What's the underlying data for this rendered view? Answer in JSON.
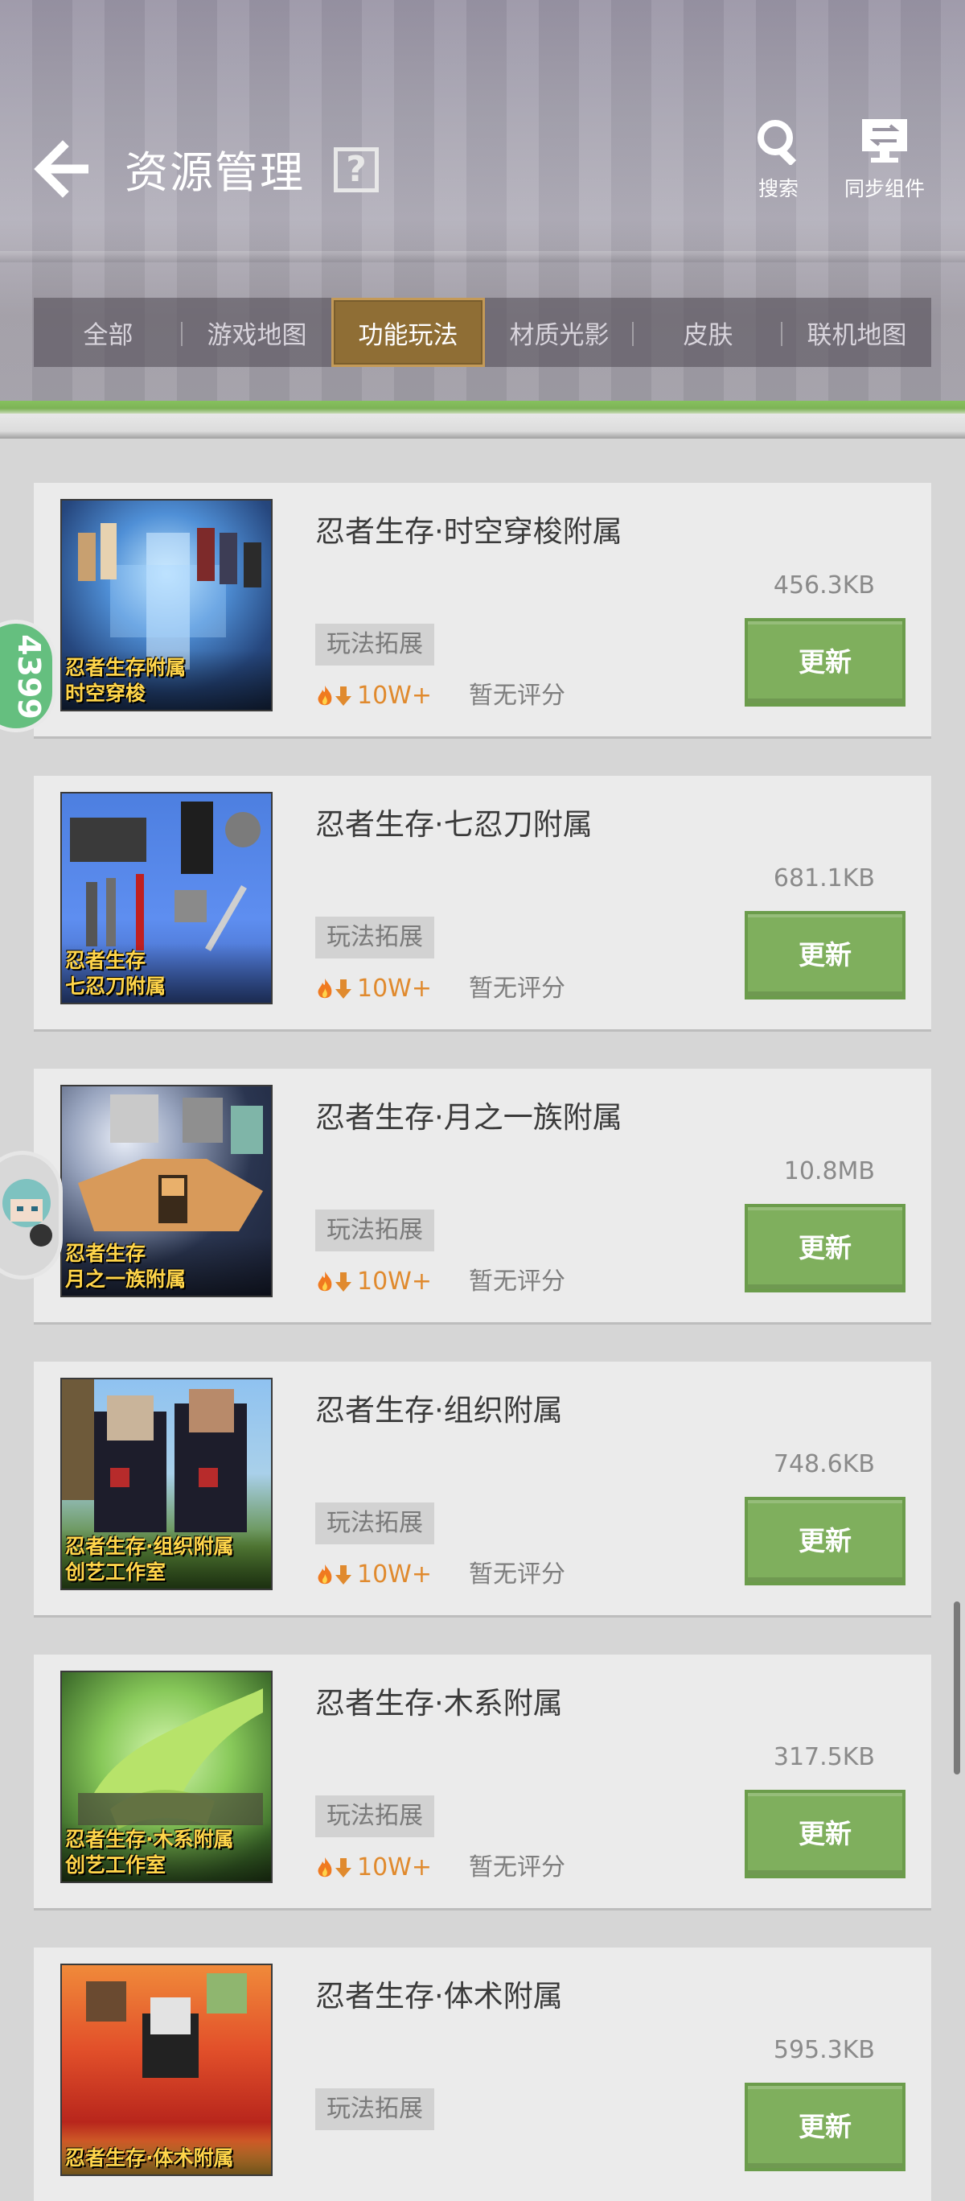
{
  "header": {
    "title": "资源管理",
    "help_label": "?",
    "search_label": "搜索",
    "sync_label": "同步组件"
  },
  "tabs": [
    {
      "label": "全部",
      "active": false
    },
    {
      "label": "游戏地图",
      "active": false
    },
    {
      "label": "功能玩法",
      "active": true
    },
    {
      "label": "材质光影",
      "active": false
    },
    {
      "label": "皮肤",
      "active": false
    },
    {
      "label": "联机地图",
      "active": false
    }
  ],
  "floating": {
    "counter_text": "4399"
  },
  "items": [
    {
      "title": "忍者生存·时空穿梭附属",
      "size": "456.3KB",
      "tag": "玩法拓展",
      "downloads": "10W+",
      "rating": "暂无评分",
      "button": "更新",
      "thumb_caption": [
        "忍者生存附属",
        "时空穿梭"
      ]
    },
    {
      "title": "忍者生存·七忍刀附属",
      "size": "681.1KB",
      "tag": "玩法拓展",
      "downloads": "10W+",
      "rating": "暂无评分",
      "button": "更新",
      "thumb_caption": [
        "忍者生存",
        "七忍刀附属"
      ]
    },
    {
      "title": "忍者生存·月之一族附属",
      "size": "10.8MB",
      "tag": "玩法拓展",
      "downloads": "10W+",
      "rating": "暂无评分",
      "button": "更新",
      "thumb_caption": [
        "忍者生存",
        "月之一族附属"
      ]
    },
    {
      "title": "忍者生存·组织附属",
      "size": "748.6KB",
      "tag": "玩法拓展",
      "downloads": "10W+",
      "rating": "暂无评分",
      "button": "更新",
      "thumb_caption": [
        "忍者生存·组织附属",
        "创艺工作室"
      ]
    },
    {
      "title": "忍者生存·木系附属",
      "size": "317.5KB",
      "tag": "玩法拓展",
      "downloads": "10W+",
      "rating": "暂无评分",
      "button": "更新",
      "thumb_caption": [
        "忍者生存·木系附属",
        "创艺工作室"
      ]
    },
    {
      "title": "忍者生存·体术附属",
      "size": "595.3KB",
      "tag": "玩法拓展",
      "downloads": "",
      "rating": "",
      "button": "更新",
      "thumb_caption": [
        "忍者生存·体术附属"
      ]
    }
  ],
  "colors": {
    "accent_green": "#7faf5d",
    "active_tab": "#8f6e35",
    "download_orange": "#e08a2e"
  },
  "icons": {
    "back": "back-arrow-icon",
    "help": "help-icon",
    "search": "search-icon",
    "sync": "sync-monitor-icon",
    "hot": "fire-icon",
    "download": "download-arrow-icon"
  }
}
